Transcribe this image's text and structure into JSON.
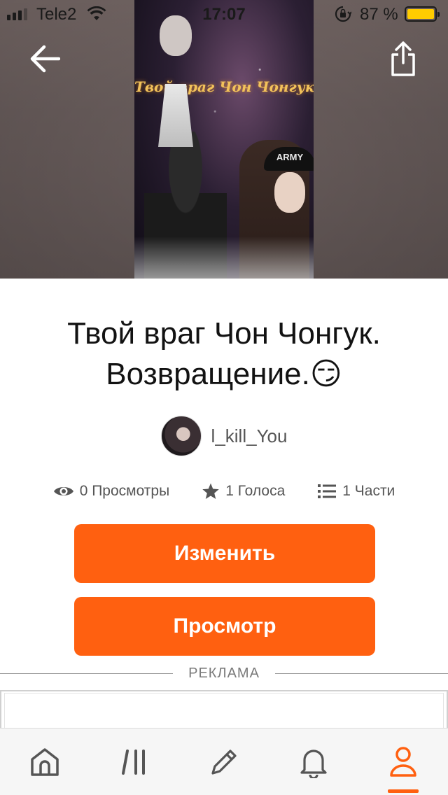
{
  "status_bar": {
    "carrier": "Tele2",
    "time": "17:07",
    "battery_percent": "87 %"
  },
  "cover": {
    "title_text": "Твой враг Чон Чонгук",
    "cap_text": "ARMY"
  },
  "story": {
    "title": "Твой враг Чон Чонгук. Возвращение.😏",
    "author": "l_kill_You",
    "stats": {
      "views": "0 Просмотры",
      "votes": "1 Голоса",
      "parts": "1 Части"
    }
  },
  "buttons": {
    "edit": "Изменить",
    "view": "Просмотр"
  },
  "ad": {
    "label": "РЕКЛАМА"
  },
  "nav": {
    "items": [
      "home-icon",
      "library-icon",
      "write-icon",
      "notifications-icon",
      "profile-icon"
    ],
    "active": "profile-icon"
  },
  "colors": {
    "accent": "#ff6010",
    "battery": "#ffcc00"
  }
}
